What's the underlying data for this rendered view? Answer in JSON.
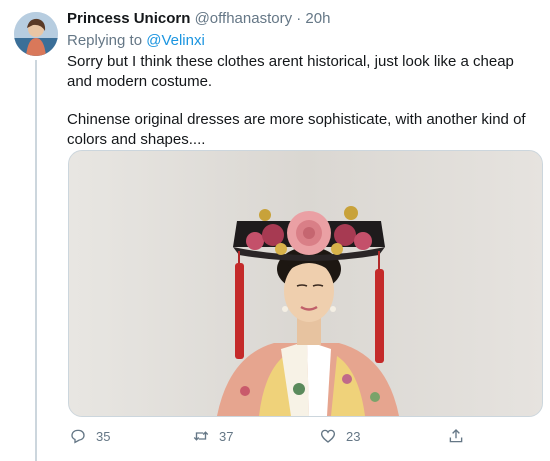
{
  "tweet": {
    "display_name": "Princess Unicorn",
    "handle": "@offhanastory",
    "separator": "·",
    "time": "20h",
    "replying_prefix": "Replying to",
    "replying_to": "@Velinxi",
    "text_paragraph_1": "Sorry but I think these clothes arent historical, just look like a cheap and modern costume.",
    "text_paragraph_2": "Chinense original dresses are more sophisticate, with another kind of colors and shapes....",
    "actions": {
      "reply_count": "35",
      "retweet_count": "37",
      "like_count": "23"
    },
    "icons": {
      "reply": "reply-icon",
      "retweet": "retweet-icon",
      "like": "heart-icon",
      "share": "share-icon"
    }
  },
  "colors": {
    "link": "#1b95e0",
    "secondary_text": "#657786",
    "primary_text": "#14171a",
    "border": "#ccd6dd"
  }
}
